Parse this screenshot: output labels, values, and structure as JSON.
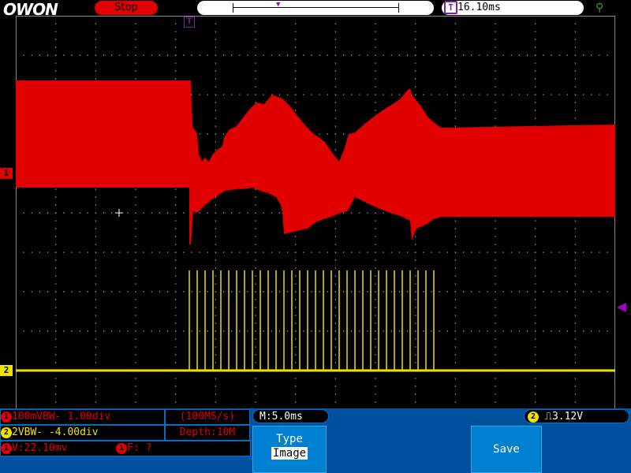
{
  "brand": {
    "logo": "OWON"
  },
  "status": {
    "run_state": "Stop"
  },
  "trigger": {
    "delay_label": "16.10ms",
    "position_icon": "trigger-position-icon"
  },
  "channels": {
    "ch1": {
      "marker": "1",
      "color": "#e00000",
      "scale_text": "100mVBW- 1.00div",
      "measure_v": "V:22.10mv",
      "measure_f": "F:  ?"
    },
    "ch2": {
      "marker": "2",
      "color": "#f0e000",
      "scale_text": "2VBW-     -4.00div"
    }
  },
  "acquisition": {
    "sample_rate": "(100MS/s)",
    "depth": "Depth:10M"
  },
  "timebase": {
    "label": "M:5.0ms"
  },
  "trigger_info": {
    "channel": "2",
    "edge_icon": "rising-edge-icon",
    "level": "3.12V"
  },
  "menu": {
    "type_title": "Type",
    "type_value": "Image",
    "save_label": "Save"
  },
  "trigger_marker": "T",
  "colors": {
    "ch1": "#e00000",
    "ch2": "#f0e000",
    "trigger": "#a000c0",
    "panel": "#0050a0"
  }
}
